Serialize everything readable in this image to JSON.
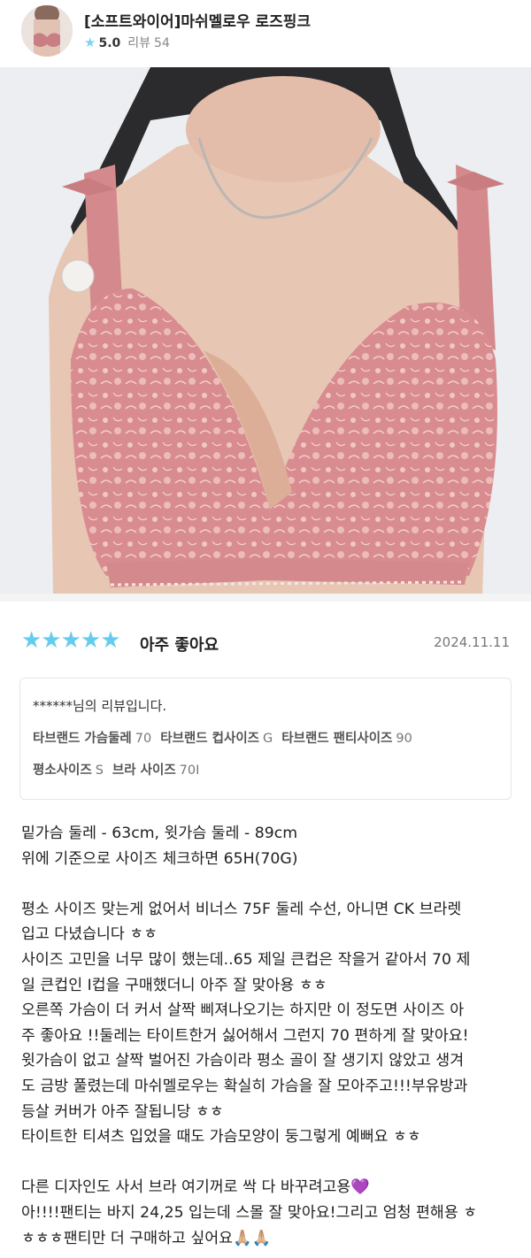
{
  "product": {
    "name": "[소프트와이어]마쉬멜로우 로즈핑크",
    "rating": "5.0",
    "review_label": "리뷰",
    "review_count": "54",
    "star_icon": "★"
  },
  "review": {
    "stars": "★★★★★",
    "headline": "아주 좋아요",
    "date": "2024.11.11",
    "reviewer": "******님의 리뷰입니다.",
    "attributes_row1": [
      {
        "label": "타브랜드 가슴둘레",
        "value": "70"
      },
      {
        "label": "타브랜드 컵사이즈",
        "value": "G"
      },
      {
        "label": "타브랜드 팬티사이즈",
        "value": "90"
      }
    ],
    "attributes_row2": [
      {
        "label": "평소사이즈",
        "value": "S"
      },
      {
        "label": "브라 사이즈",
        "value": "70I"
      }
    ],
    "body_lines": [
      "밑가슴 둘레 - 63cm, 윗가슴 둘레 - 89cm",
      "위에 기준으로 사이즈 체크하면 65H(70G)",
      "",
      "평소 사이즈 맞는게 없어서 비너스 75F 둘레 수선, 아니면 CK 브라렛",
      "입고 다녔습니다 ㅎㅎ",
      "사이즈 고민을 너무 많이 했는데..65 제일 큰컵은 작을거 같아서 70 제",
      "일 큰컵인 I컵을 구매했더니 아주 잘 맞아용 ㅎㅎ",
      "오른쪽 가슴이 더 커서 살짝 삐져나오기는 하지만 이 정도면 사이즈 아",
      "주 좋아요 !!둘레는 타이트한거 싫어해서 그런지 70 편하게 잘 맞아요!",
      "윗가슴이 없고 살짝 벌어진 가슴이라 평소 골이 잘 생기지 않았고 생겨",
      "도 금방 풀렸는데 마쉬멜로우는 확실히 가슴을 잘 모아주고!!!부유방과",
      "등살 커버가 아주 잘됩니당 ㅎㅎ",
      "타이트한 티셔츠 입었을 때도 가슴모양이 둥그렇게 예뻐요 ㅎㅎ",
      "",
      "다른 디자인도 사서 브라 여기꺼로 싹 다 바꾸려고용💜",
      "아!!!!팬티는 바지 24,25 입는데 스몰 잘 맞아요!그리고 엄청 편해용 ㅎ",
      "ㅎㅎㅎ팬티만 더 구매하고 싶어요🙏🏼🙏🏼"
    ]
  },
  "colors": {
    "star": "#66ccef",
    "bra_pink": "#d98c8f",
    "background": "#ffffff"
  }
}
